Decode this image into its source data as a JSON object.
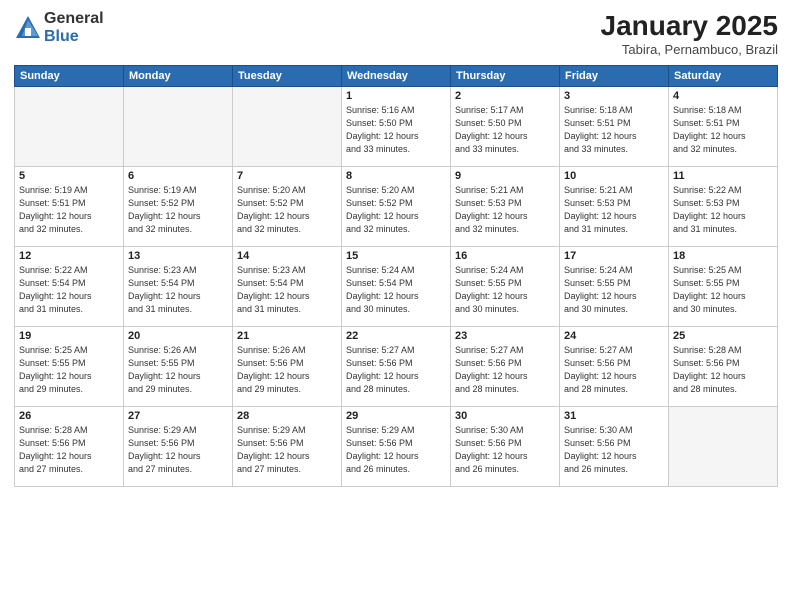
{
  "logo": {
    "general": "General",
    "blue": "Blue"
  },
  "title": "January 2025",
  "subtitle": "Tabira, Pernambuco, Brazil",
  "weekdays": [
    "Sunday",
    "Monday",
    "Tuesday",
    "Wednesday",
    "Thursday",
    "Friday",
    "Saturday"
  ],
  "weeks": [
    [
      {
        "day": "",
        "info": ""
      },
      {
        "day": "",
        "info": ""
      },
      {
        "day": "",
        "info": ""
      },
      {
        "day": "1",
        "info": "Sunrise: 5:16 AM\nSunset: 5:50 PM\nDaylight: 12 hours\nand 33 minutes."
      },
      {
        "day": "2",
        "info": "Sunrise: 5:17 AM\nSunset: 5:50 PM\nDaylight: 12 hours\nand 33 minutes."
      },
      {
        "day": "3",
        "info": "Sunrise: 5:18 AM\nSunset: 5:51 PM\nDaylight: 12 hours\nand 33 minutes."
      },
      {
        "day": "4",
        "info": "Sunrise: 5:18 AM\nSunset: 5:51 PM\nDaylight: 12 hours\nand 32 minutes."
      }
    ],
    [
      {
        "day": "5",
        "info": "Sunrise: 5:19 AM\nSunset: 5:51 PM\nDaylight: 12 hours\nand 32 minutes."
      },
      {
        "day": "6",
        "info": "Sunrise: 5:19 AM\nSunset: 5:52 PM\nDaylight: 12 hours\nand 32 minutes."
      },
      {
        "day": "7",
        "info": "Sunrise: 5:20 AM\nSunset: 5:52 PM\nDaylight: 12 hours\nand 32 minutes."
      },
      {
        "day": "8",
        "info": "Sunrise: 5:20 AM\nSunset: 5:52 PM\nDaylight: 12 hours\nand 32 minutes."
      },
      {
        "day": "9",
        "info": "Sunrise: 5:21 AM\nSunset: 5:53 PM\nDaylight: 12 hours\nand 32 minutes."
      },
      {
        "day": "10",
        "info": "Sunrise: 5:21 AM\nSunset: 5:53 PM\nDaylight: 12 hours\nand 31 minutes."
      },
      {
        "day": "11",
        "info": "Sunrise: 5:22 AM\nSunset: 5:53 PM\nDaylight: 12 hours\nand 31 minutes."
      }
    ],
    [
      {
        "day": "12",
        "info": "Sunrise: 5:22 AM\nSunset: 5:54 PM\nDaylight: 12 hours\nand 31 minutes."
      },
      {
        "day": "13",
        "info": "Sunrise: 5:23 AM\nSunset: 5:54 PM\nDaylight: 12 hours\nand 31 minutes."
      },
      {
        "day": "14",
        "info": "Sunrise: 5:23 AM\nSunset: 5:54 PM\nDaylight: 12 hours\nand 31 minutes."
      },
      {
        "day": "15",
        "info": "Sunrise: 5:24 AM\nSunset: 5:54 PM\nDaylight: 12 hours\nand 30 minutes."
      },
      {
        "day": "16",
        "info": "Sunrise: 5:24 AM\nSunset: 5:55 PM\nDaylight: 12 hours\nand 30 minutes."
      },
      {
        "day": "17",
        "info": "Sunrise: 5:24 AM\nSunset: 5:55 PM\nDaylight: 12 hours\nand 30 minutes."
      },
      {
        "day": "18",
        "info": "Sunrise: 5:25 AM\nSunset: 5:55 PM\nDaylight: 12 hours\nand 30 minutes."
      }
    ],
    [
      {
        "day": "19",
        "info": "Sunrise: 5:25 AM\nSunset: 5:55 PM\nDaylight: 12 hours\nand 29 minutes."
      },
      {
        "day": "20",
        "info": "Sunrise: 5:26 AM\nSunset: 5:55 PM\nDaylight: 12 hours\nand 29 minutes."
      },
      {
        "day": "21",
        "info": "Sunrise: 5:26 AM\nSunset: 5:56 PM\nDaylight: 12 hours\nand 29 minutes."
      },
      {
        "day": "22",
        "info": "Sunrise: 5:27 AM\nSunset: 5:56 PM\nDaylight: 12 hours\nand 28 minutes."
      },
      {
        "day": "23",
        "info": "Sunrise: 5:27 AM\nSunset: 5:56 PM\nDaylight: 12 hours\nand 28 minutes."
      },
      {
        "day": "24",
        "info": "Sunrise: 5:27 AM\nSunset: 5:56 PM\nDaylight: 12 hours\nand 28 minutes."
      },
      {
        "day": "25",
        "info": "Sunrise: 5:28 AM\nSunset: 5:56 PM\nDaylight: 12 hours\nand 28 minutes."
      }
    ],
    [
      {
        "day": "26",
        "info": "Sunrise: 5:28 AM\nSunset: 5:56 PM\nDaylight: 12 hours\nand 27 minutes."
      },
      {
        "day": "27",
        "info": "Sunrise: 5:29 AM\nSunset: 5:56 PM\nDaylight: 12 hours\nand 27 minutes."
      },
      {
        "day": "28",
        "info": "Sunrise: 5:29 AM\nSunset: 5:56 PM\nDaylight: 12 hours\nand 27 minutes."
      },
      {
        "day": "29",
        "info": "Sunrise: 5:29 AM\nSunset: 5:56 PM\nDaylight: 12 hours\nand 26 minutes."
      },
      {
        "day": "30",
        "info": "Sunrise: 5:30 AM\nSunset: 5:56 PM\nDaylight: 12 hours\nand 26 minutes."
      },
      {
        "day": "31",
        "info": "Sunrise: 5:30 AM\nSunset: 5:56 PM\nDaylight: 12 hours\nand 26 minutes."
      },
      {
        "day": "",
        "info": ""
      }
    ]
  ]
}
